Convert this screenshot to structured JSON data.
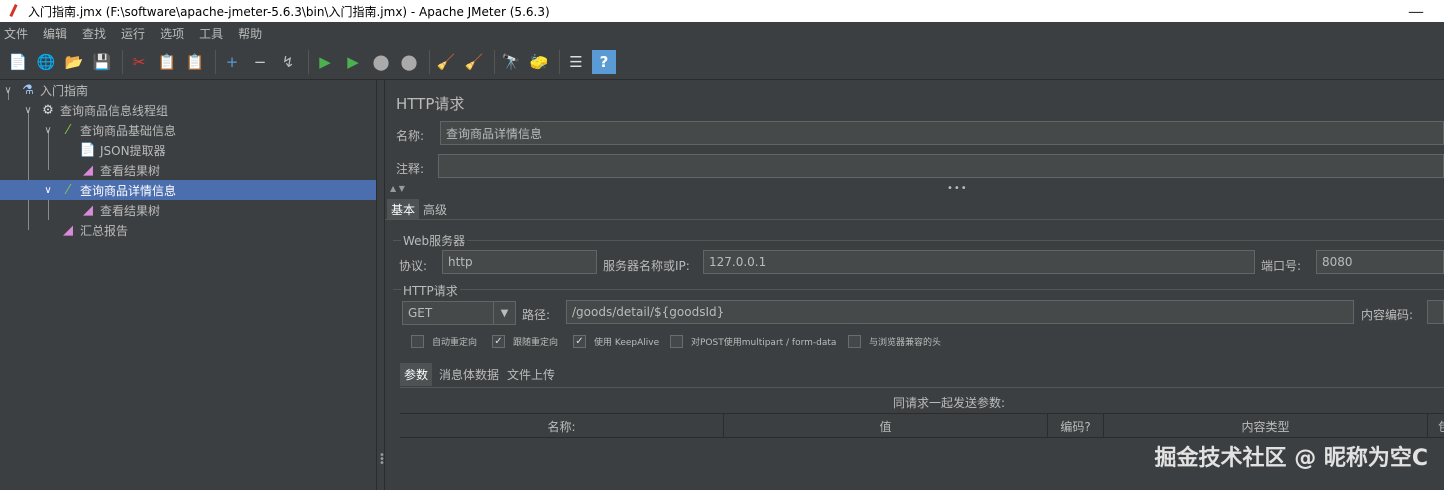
{
  "window": {
    "title": "入门指南.jmx (F:\\software\\apache-jmeter-5.6.3\\bin\\入门指南.jmx) - Apache JMeter (5.6.3)",
    "minimize": "—"
  },
  "menu": [
    "文件",
    "编辑",
    "查找",
    "运行",
    "选项",
    "工具",
    "帮助"
  ],
  "toolbar": {
    "icons": [
      "new-icon",
      "templates-icon",
      "open-icon",
      "save-icon",
      "cut-icon",
      "copy-icon",
      "paste-icon",
      "expand-icon",
      "collapse-icon",
      "toggle-icon",
      "start-icon",
      "start-no-pause-icon",
      "stop-icon",
      "shutdown-icon",
      "clear-icon",
      "clear-all-icon",
      "search-icon",
      "reset-search-icon",
      "function-helper-icon",
      "help-icon"
    ],
    "glyphs": [
      "📄",
      "🌐",
      "📂",
      "💾",
      "✂",
      "📋",
      "📋",
      "+",
      "−",
      "↯",
      "▶",
      "▶",
      "⬤",
      "⬤",
      "🧹",
      "🧹",
      "🔭",
      "🧽",
      "☰",
      "?"
    ]
  },
  "tree": {
    "items": [
      {
        "label": "入门指南",
        "icon": "flask-icon",
        "glyph": "⚗",
        "chev": "∨",
        "indent": 0
      },
      {
        "label": "查询商品信息线程组",
        "icon": "gear-icon",
        "glyph": "⚙",
        "chev": "∨",
        "indent": 1
      },
      {
        "label": "查询商品基础信息",
        "icon": "pipette-icon",
        "glyph": "⁄",
        "chev": "∨",
        "indent": 2
      },
      {
        "label": "JSON提取器",
        "icon": "document-icon",
        "glyph": "📄",
        "chev": "",
        "indent": 3
      },
      {
        "label": "查看结果树",
        "icon": "chart-icon",
        "glyph": "◢",
        "chev": "",
        "indent": 3
      },
      {
        "label": "查询商品详情信息",
        "icon": "pipette-icon",
        "glyph": "⁄",
        "chev": "∨",
        "indent": 2,
        "selected": true
      },
      {
        "label": "查看结果树",
        "icon": "chart-icon",
        "glyph": "◢",
        "chev": "",
        "indent": 3
      },
      {
        "label": "汇总报告",
        "icon": "chart-icon",
        "glyph": "◢",
        "chev": "",
        "indent": 2
      }
    ]
  },
  "panel": {
    "title": "HTTP请求",
    "name_label": "名称:",
    "name_value": "查询商品详情信息",
    "comment_label": "注释:",
    "comment_value": "",
    "splitter_arrows": "▲ ▼",
    "splitter_dots": "•••",
    "tabs": [
      "基本",
      "高级"
    ],
    "web_server": {
      "group_label": "Web服务器",
      "protocol_label": "协议:",
      "protocol_value": "http",
      "server_label": "服务器名称或IP:",
      "server_value": "127.0.0.1",
      "port_label": "端口号:",
      "port_value": "8080"
    },
    "http_request": {
      "group_label": "HTTP请求",
      "method": "GET",
      "path_label": "路径:",
      "path_value": "/goods/detail/${goodsId}",
      "encoding_label": "内容编码:",
      "encoding_value": ""
    },
    "checkboxes": [
      {
        "label": "自动重定向",
        "checked": false
      },
      {
        "label": "跟随重定向",
        "checked": true
      },
      {
        "label": "使用 KeepAlive",
        "checked": true
      },
      {
        "label": "对POST使用multipart / form-data",
        "checked": false
      },
      {
        "label": "与浏览器兼容的头",
        "checked": false
      }
    ],
    "sub_tabs": [
      "参数",
      "消息体数据",
      "文件上传"
    ],
    "params_title": "同请求一起发送参数:",
    "columns": [
      "名称:",
      "值",
      "编码?",
      "内容类型",
      "包"
    ]
  },
  "watermark": "掘金技术社区 @ 昵称为空C"
}
